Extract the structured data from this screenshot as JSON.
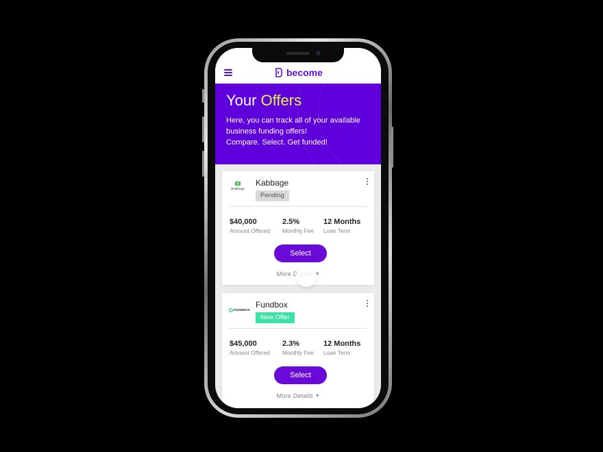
{
  "app": {
    "brand": "become"
  },
  "hero": {
    "title_prefix": "Your",
    "title_accent": "Offers",
    "line1": "Here, you can track all of your available",
    "line2": "business funding offers!",
    "line3": "Compare. Select. Get funded!"
  },
  "offers": [
    {
      "lender": "Kabbage",
      "logo_text": "Kabbage",
      "status": "Pending",
      "amount": "$40,000",
      "amount_label": "Amount Offered",
      "fee": "2.5%",
      "fee_label": "Monthly Fee",
      "term": "12 Months",
      "term_label": "Loan Term",
      "select_label": "Select",
      "more_label": "More Details"
    },
    {
      "lender": "Fundbox",
      "logo_text": "FUNDBOX",
      "status": "New Offer",
      "amount": "$45,000",
      "amount_label": "Amount Offered",
      "fee": "2.3%",
      "fee_label": "Monthly Fee",
      "term": "12 Months",
      "term_label": "Loan Term",
      "select_label": "Select",
      "more_label": "More Details"
    }
  ],
  "colors": {
    "brand_purple": "#5f00dc",
    "accent_yellow": "#e4f24a",
    "pending_badge": "#d9d9d9",
    "new_offer_badge": "#3de3a6"
  }
}
